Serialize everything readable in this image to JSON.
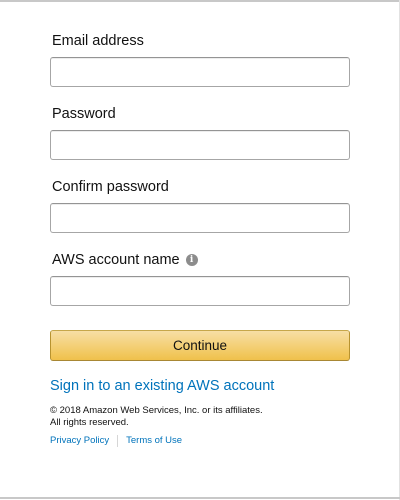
{
  "form": {
    "fields": [
      {
        "label": "Email address",
        "value": "",
        "placeholder": ""
      },
      {
        "label": "Password",
        "value": "",
        "placeholder": ""
      },
      {
        "label": "Confirm password",
        "value": "",
        "placeholder": ""
      },
      {
        "label": "AWS account name",
        "value": "",
        "placeholder": "",
        "info_icon": "info-circle-icon"
      }
    ],
    "continue_label": "Continue",
    "signin_link": "Sign in to an existing AWS account"
  },
  "footer": {
    "copyright_line1": "© 2018 Amazon Web Services, Inc. or its affiliates.",
    "copyright_line2": "All rights reserved.",
    "privacy_label": "Privacy Policy",
    "terms_label": "Terms of Use"
  },
  "colors": {
    "link": "#0073bb",
    "button_top": "#f7dfa5",
    "button_bottom": "#f0c14b",
    "button_border": "#a88734",
    "input_border": "#a6a6a6"
  }
}
